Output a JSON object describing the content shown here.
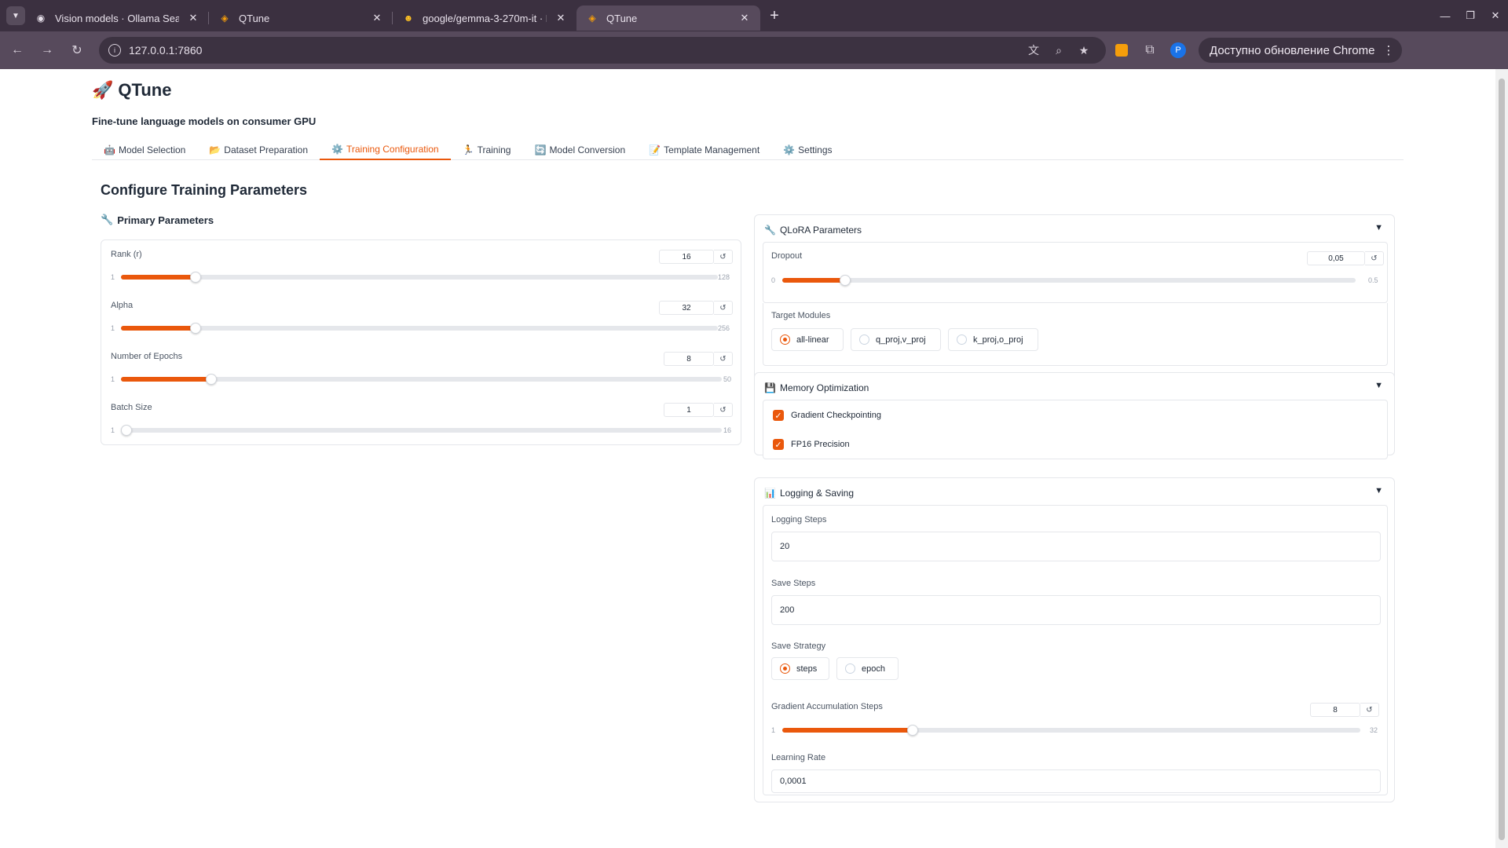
{
  "browser": {
    "tabs": [
      {
        "title": "Vision models · Ollama Search",
        "icon": "ollama-icon"
      },
      {
        "title": "QTune",
        "icon": "qtune-icon"
      },
      {
        "title": "google/gemma-3-270m-it · Hugging Face",
        "icon": "hugging-face-icon"
      },
      {
        "title": "QTune",
        "icon": "qtune-icon"
      }
    ],
    "active_tab_index": 3,
    "url": "127.0.0.1:7860",
    "profile_initial": "P",
    "update_label": "Доступно обновление Chrome"
  },
  "app": {
    "title": "QTune",
    "subtitle": "Fine-tune language models on consumer GPU"
  },
  "nav_tabs": [
    {
      "label": "Model Selection",
      "icon": "🤖"
    },
    {
      "label": "Dataset Preparation",
      "icon": "📂"
    },
    {
      "label": "Training Configuration",
      "icon": "⚙️"
    },
    {
      "label": "Training",
      "icon": "🏃"
    },
    {
      "label": "Model Conversion",
      "icon": "🔄"
    },
    {
      "label": "Template Management",
      "icon": "📝"
    },
    {
      "label": "Settings",
      "icon": "⚙️"
    }
  ],
  "active_nav_index": 2,
  "page_title": "Configure Training Parameters",
  "primary": {
    "heading": "Primary Parameters",
    "sliders": [
      {
        "label": "Rank (r)",
        "value": "16",
        "min": "1",
        "max": "128",
        "fraction": 0.125
      },
      {
        "label": "Alpha",
        "value": "32",
        "min": "1",
        "max": "256",
        "fraction": 0.125
      },
      {
        "label": "Number of Epochs",
        "value": "8",
        "min": "1",
        "max": "50",
        "fraction": 0.15
      },
      {
        "label": "Batch Size",
        "value": "1",
        "min": "1",
        "max": "16",
        "fraction": 0.0
      }
    ]
  },
  "qlora": {
    "heading": "QLoRA Parameters",
    "dropout": {
      "label": "Dropout",
      "value": "0,05",
      "min": "0",
      "max": "0.5",
      "fraction": 0.11
    },
    "target_label": "Target Modules",
    "targets": [
      "all-linear",
      "q_proj,v_proj",
      "k_proj,o_proj"
    ],
    "target_selected": 0
  },
  "memory": {
    "heading": "Memory Optimization",
    "gradient_checkpointing": "Gradient Checkpointing",
    "fp16": "FP16 Precision"
  },
  "logging": {
    "heading": "Logging & Saving",
    "logging_steps_label": "Logging Steps",
    "logging_steps": "20",
    "save_steps_label": "Save Steps",
    "save_steps": "200",
    "save_strategy_label": "Save Strategy",
    "strategies": [
      "steps",
      "epoch"
    ],
    "strategy_selected": 0,
    "grad_accum": {
      "label": "Gradient Accumulation Steps",
      "value": "8",
      "min": "1",
      "max": "32",
      "fraction": 0.226
    },
    "lr_label": "Learning Rate",
    "lr": "0,0001"
  }
}
